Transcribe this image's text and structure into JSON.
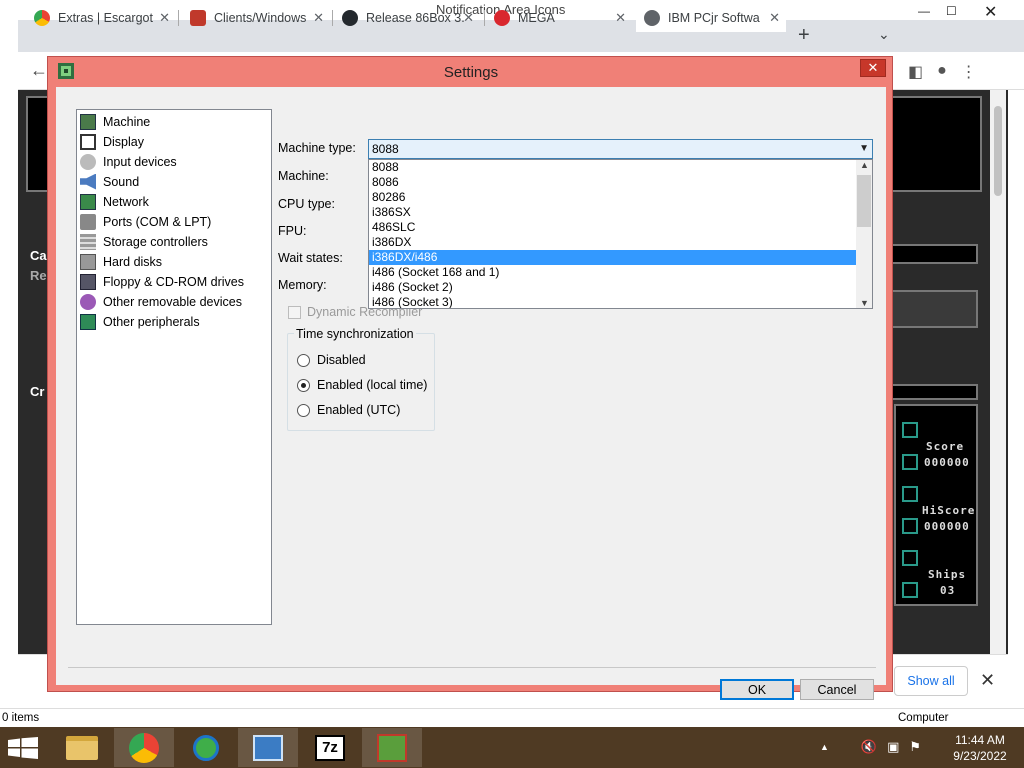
{
  "window_title": "Notification Area Icons",
  "browser": {
    "tabs": [
      {
        "label": "Extras | Escargot",
        "color": "#fbbc05"
      },
      {
        "label": "Clients/Windows",
        "color": "#c0392b"
      },
      {
        "label": "Release 86Box 3.",
        "color": "#24292e"
      },
      {
        "label": "MEGA",
        "color": "#d9272e"
      },
      {
        "label": "IBM PCjr Softwa",
        "color": "#5f6368"
      }
    ],
    "new_tab": "+",
    "show_all": "Show all",
    "status_left": "0 items",
    "status_right": "Computer"
  },
  "game": {
    "score_label": "Score",
    "score_value": "000000",
    "hiscore_label": "HiScore",
    "hiscore_value": "000000",
    "ships_label": "Ships",
    "ships_value": "03",
    "side_label_1": "Ca",
    "side_label_2": "Re",
    "side_label_3": "Cr"
  },
  "dialog": {
    "title": "Settings",
    "close": "✕",
    "categories": [
      {
        "label": "Machine",
        "icon": "machine-icon"
      },
      {
        "label": "Display",
        "icon": "display-icon"
      },
      {
        "label": "Input devices",
        "icon": "input-devices-icon"
      },
      {
        "label": "Sound",
        "icon": "sound-icon"
      },
      {
        "label": "Network",
        "icon": "network-icon"
      },
      {
        "label": "Ports (COM & LPT)",
        "icon": "ports-icon"
      },
      {
        "label": "Storage controllers",
        "icon": "storage-icon"
      },
      {
        "label": "Hard disks",
        "icon": "hard-disk-icon"
      },
      {
        "label": "Floppy & CD-ROM drives",
        "icon": "floppy-icon"
      },
      {
        "label": "Other removable devices",
        "icon": "removable-icon"
      },
      {
        "label": "Other peripherals",
        "icon": "peripherals-icon"
      }
    ],
    "labels": {
      "machine_type": "Machine type:",
      "machine": "Machine:",
      "cpu_type": "CPU type:",
      "fpu": "FPU:",
      "wait_states": "Wait states:",
      "memory": "Memory:"
    },
    "machine_type_value": "8088",
    "machine_type_options": [
      "8088",
      "8086",
      "80286",
      "i386SX",
      "486SLC",
      "i386DX",
      "i386DX/i486",
      "i486 (Socket 168 and 1)",
      "i486 (Socket 2)",
      "i486 (Socket 3)"
    ],
    "highlighted_option": "i386DX/i486",
    "dynamic_recompiler": "Dynamic Recompiler",
    "time_sync": {
      "legend": "Time synchronization",
      "options": [
        "Disabled",
        "Enabled (local time)",
        "Enabled (UTC)"
      ],
      "selected": "Enabled (local time)"
    },
    "ok": "OK",
    "cancel": "Cancel"
  },
  "taskbar": {
    "time": "11:44 AM",
    "date": "9/23/2022",
    "sevenzip": "7z"
  }
}
